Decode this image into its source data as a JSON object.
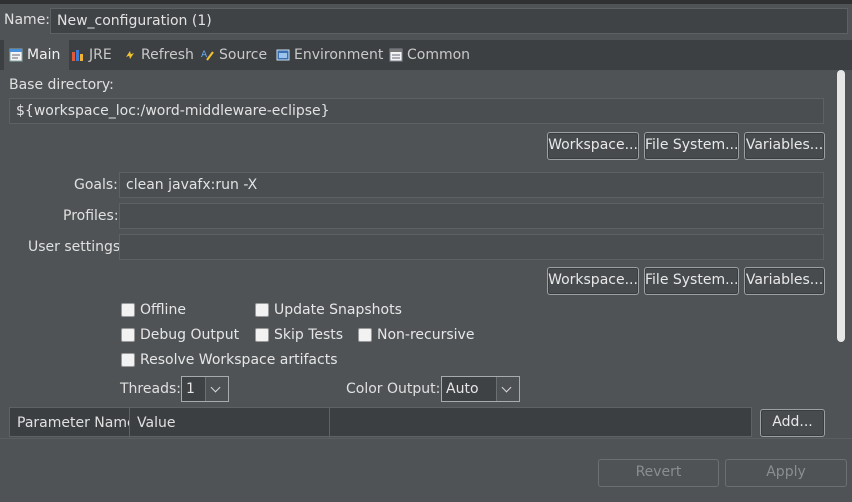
{
  "name": {
    "label": "Name:",
    "value": "New_configuration (1)"
  },
  "tabs": [
    {
      "label": "Main",
      "icon": "main-tab-icon",
      "active": true
    },
    {
      "label": "JRE",
      "icon": "jre-icon"
    },
    {
      "label": "Refresh",
      "icon": "refresh-icon"
    },
    {
      "label": "Source",
      "icon": "source-icon"
    },
    {
      "label": "Environment",
      "icon": "environment-icon"
    },
    {
      "label": "Common",
      "icon": "common-icon"
    }
  ],
  "base_directory": {
    "label": "Base directory:",
    "value": "${workspace_loc:/word-middleware-eclipse}",
    "buttons": {
      "workspace": "Workspace...",
      "file_system": "File System...",
      "variables": "Variables..."
    }
  },
  "goals": {
    "label": "Goals:",
    "value": "clean javafx:run -X"
  },
  "profiles": {
    "label": "Profiles:",
    "value": ""
  },
  "user_settings": {
    "label": "User settings:",
    "value": "",
    "buttons": {
      "workspace": "Workspace...",
      "file_system": "File System...",
      "variables": "Variables..."
    }
  },
  "options": {
    "offline": "Offline",
    "update_snapshots": "Update Snapshots",
    "debug_output": "Debug Output",
    "skip_tests": "Skip Tests",
    "non_recursive": "Non-recursive",
    "resolve_workspace": "Resolve Workspace artifacts"
  },
  "threads": {
    "label": "Threads:",
    "value": "1"
  },
  "color_output": {
    "label": "Color Output:",
    "value": "Auto"
  },
  "params_table": {
    "columns": [
      "Parameter Name",
      "Value"
    ],
    "add_label": "Add..."
  },
  "footer": {
    "revert": "Revert",
    "apply": "Apply"
  }
}
